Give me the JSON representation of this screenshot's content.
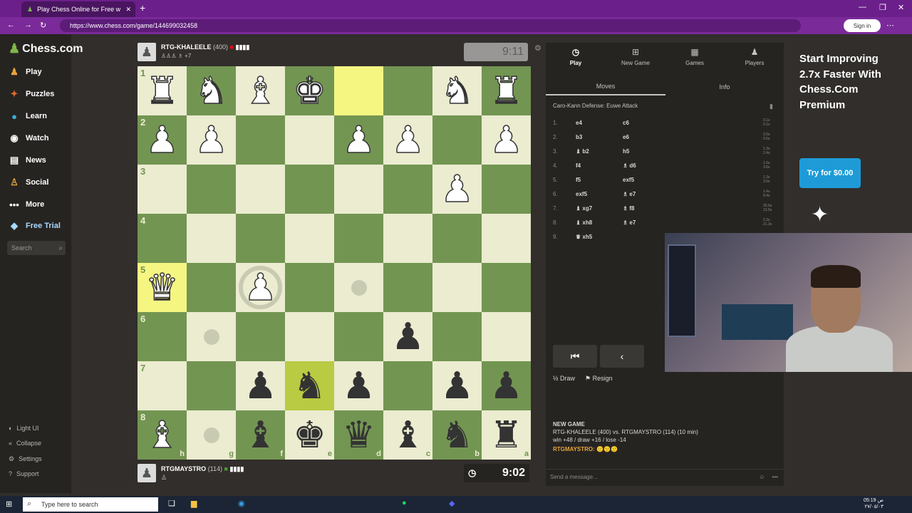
{
  "browser": {
    "tab_title": "Play Chess Online for Free w",
    "url": "https://www.chess.com/game/144699032458",
    "signin": "Sign in"
  },
  "sidebar": {
    "logo": "Chess.com",
    "items": [
      {
        "label": "Play",
        "icon": "play-icon"
      },
      {
        "label": "Puzzles",
        "icon": "puzzles-icon"
      },
      {
        "label": "Learn",
        "icon": "learn-icon"
      },
      {
        "label": "Watch",
        "icon": "watch-icon"
      },
      {
        "label": "News",
        "icon": "news-icon"
      },
      {
        "label": "Social",
        "icon": "social-icon"
      },
      {
        "label": "More",
        "icon": "more-icon"
      },
      {
        "label": "Free Trial",
        "icon": "diamond-icon"
      }
    ],
    "search_placeholder": "Search",
    "bottom": [
      {
        "label": "Light UI"
      },
      {
        "label": "Collapse"
      },
      {
        "label": "Settings"
      },
      {
        "label": "Support"
      }
    ]
  },
  "top_player": {
    "name": "RTG-KHALEELE",
    "rating": "(400)",
    "captured": "+7",
    "clock": "9:11"
  },
  "bottom_player": {
    "name": "RTGMAYSTRO",
    "rating": "(114)",
    "clock": "9:02"
  },
  "board": {
    "ranks": [
      "1",
      "2",
      "3",
      "4",
      "5",
      "6",
      "7",
      "8"
    ],
    "files": [
      "h",
      "g",
      "f",
      "e",
      "d",
      "c",
      "b",
      "a"
    ],
    "rows": [
      [
        "wr",
        "wn",
        "wb",
        "wk",
        "",
        "",
        "wn",
        "wr"
      ],
      [
        "wp",
        "wp",
        "",
        "",
        "wp",
        "wp",
        "",
        "wp"
      ],
      [
        "",
        "",
        "",
        "",
        "",
        "",
        "wp",
        ""
      ],
      [
        "",
        "",
        "",
        "",
        "",
        "",
        "",
        ""
      ],
      [
        "wq",
        "",
        "wp",
        "",
        "",
        "",
        "",
        ""
      ],
      [
        "",
        "",
        "",
        "",
        "",
        "bp",
        "",
        ""
      ],
      [
        "",
        "",
        "bp",
        "bn",
        "bp",
        "",
        "bp",
        "bp"
      ],
      [
        "wb",
        "",
        "bb",
        "bk",
        "bq",
        "bb",
        "bn",
        "br"
      ]
    ],
    "highlight": [
      [
        0,
        4
      ],
      [
        4,
        0
      ],
      [
        6,
        3
      ]
    ],
    "dots": [
      [
        4,
        4
      ],
      [
        5,
        1
      ],
      [
        7,
        1
      ]
    ],
    "rings": [
      [
        4,
        2
      ]
    ]
  },
  "panel": {
    "tabs": [
      {
        "label": "Play",
        "icon": "play-clock-icon"
      },
      {
        "label": "New Game",
        "icon": "plus-icon"
      },
      {
        "label": "Games",
        "icon": "games-icon"
      },
      {
        "label": "Players",
        "icon": "players-icon"
      }
    ],
    "subtabs": [
      "Moves",
      "Info"
    ],
    "opening": "Caro-Kann Defense: Euwe Attack",
    "moves": [
      {
        "n": "1.",
        "w": "e4",
        "b": "c6",
        "t": [
          "0.1s",
          "0.1s"
        ]
      },
      {
        "n": "2.",
        "w": "b3",
        "b": "e6",
        "t": [
          "2.0s",
          "0.5s"
        ]
      },
      {
        "n": "3.",
        "w": "♝ b2",
        "b": "h5",
        "t": [
          "1.3s",
          "2.4s"
        ]
      },
      {
        "n": "4.",
        "w": "f4",
        "b": "♗ d6",
        "t": [
          "1.5s",
          "3.6s"
        ]
      },
      {
        "n": "5.",
        "w": "f5",
        "b": "exf5",
        "t": [
          "1.3s",
          "3.0s"
        ]
      },
      {
        "n": "6.",
        "w": "exf5",
        "b": "♗ e7",
        "t": [
          "1.4s",
          "9.4s"
        ]
      },
      {
        "n": "7.",
        "w": "♝ xg7",
        "b": "♗ f8",
        "t": [
          "26.6s",
          "12.5s"
        ]
      },
      {
        "n": "8.",
        "w": "♝ xh8",
        "b": "♗ e7",
        "t": [
          "2.3s",
          "21.3s"
        ]
      },
      {
        "n": "9.",
        "w": "♛ xh5",
        "b": "",
        "t": [
          "",
          ""
        ]
      }
    ],
    "draw": "Draw",
    "resign": "Resign",
    "log": {
      "title": "NEW GAME",
      "line1": "RTG-KHALEELE (400) vs. RTGMAYSTRO (114) (10 min)",
      "line2": "win +48 / draw +16 / lose -14",
      "chat_user": "RTGMAYSTRO:",
      "chat_msg": "🙂🙂🙂"
    },
    "message_placeholder": "Send a message..."
  },
  "ad": {
    "text": "Start Improving 2.7x Faster With Chess.Com Premium",
    "button": "Try for $0.00"
  },
  "taskbar": {
    "search": "Type here to search",
    "time": "05:19 ص",
    "date": "٢٧/٠٥/٠٣"
  }
}
